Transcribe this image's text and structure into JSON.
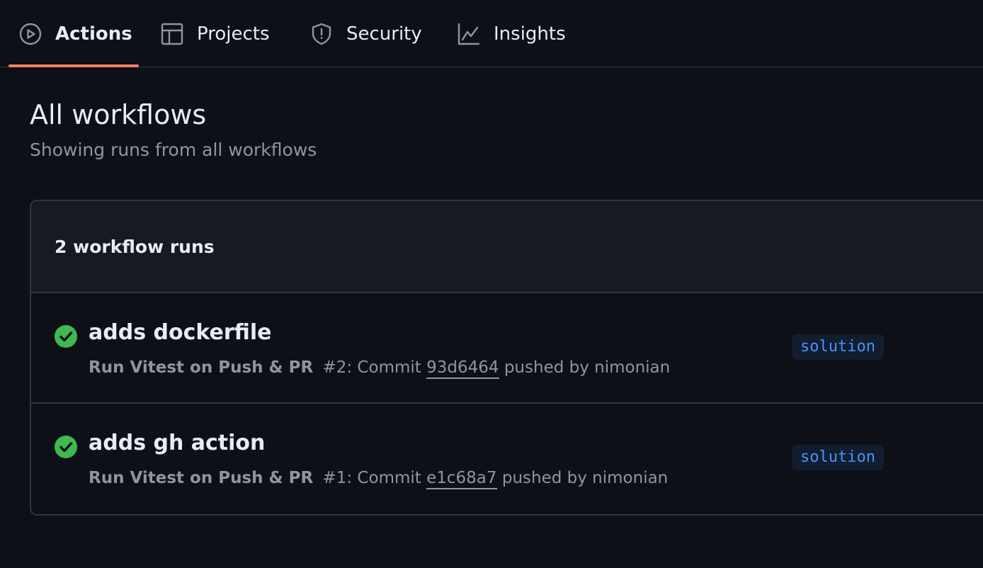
{
  "tabs": [
    {
      "label": "Actions",
      "icon": "play-circle-icon",
      "active": true
    },
    {
      "label": "Projects",
      "icon": "table-icon",
      "active": false
    },
    {
      "label": "Security",
      "icon": "shield-icon",
      "active": false
    },
    {
      "label": "Insights",
      "icon": "graph-icon",
      "active": false
    }
  ],
  "header": {
    "title": "All workflows",
    "subtitle": "Showing runs from all workflows"
  },
  "runs": {
    "count_label": "2 workflow runs",
    "items": [
      {
        "title": "adds dockerfile",
        "status": "success",
        "workflow": "Run Vitest on Push & PR",
        "run_number": "#2",
        "commit_prefix": ": Commit ",
        "commit_sha": "93d6464",
        "pushed_by": " pushed by nimonian",
        "branch": "solution"
      },
      {
        "title": "adds gh action",
        "status": "success",
        "workflow": "Run Vitest on Push & PR",
        "run_number": "#1",
        "commit_prefix": ": Commit ",
        "commit_sha": "e1c68a7",
        "pushed_by": " pushed by nimonian",
        "branch": "solution"
      }
    ]
  },
  "colors": {
    "background": "#0d1117",
    "success": "#3fb950",
    "accent_underline": "#f78166",
    "branch_text": "#4493f8"
  }
}
